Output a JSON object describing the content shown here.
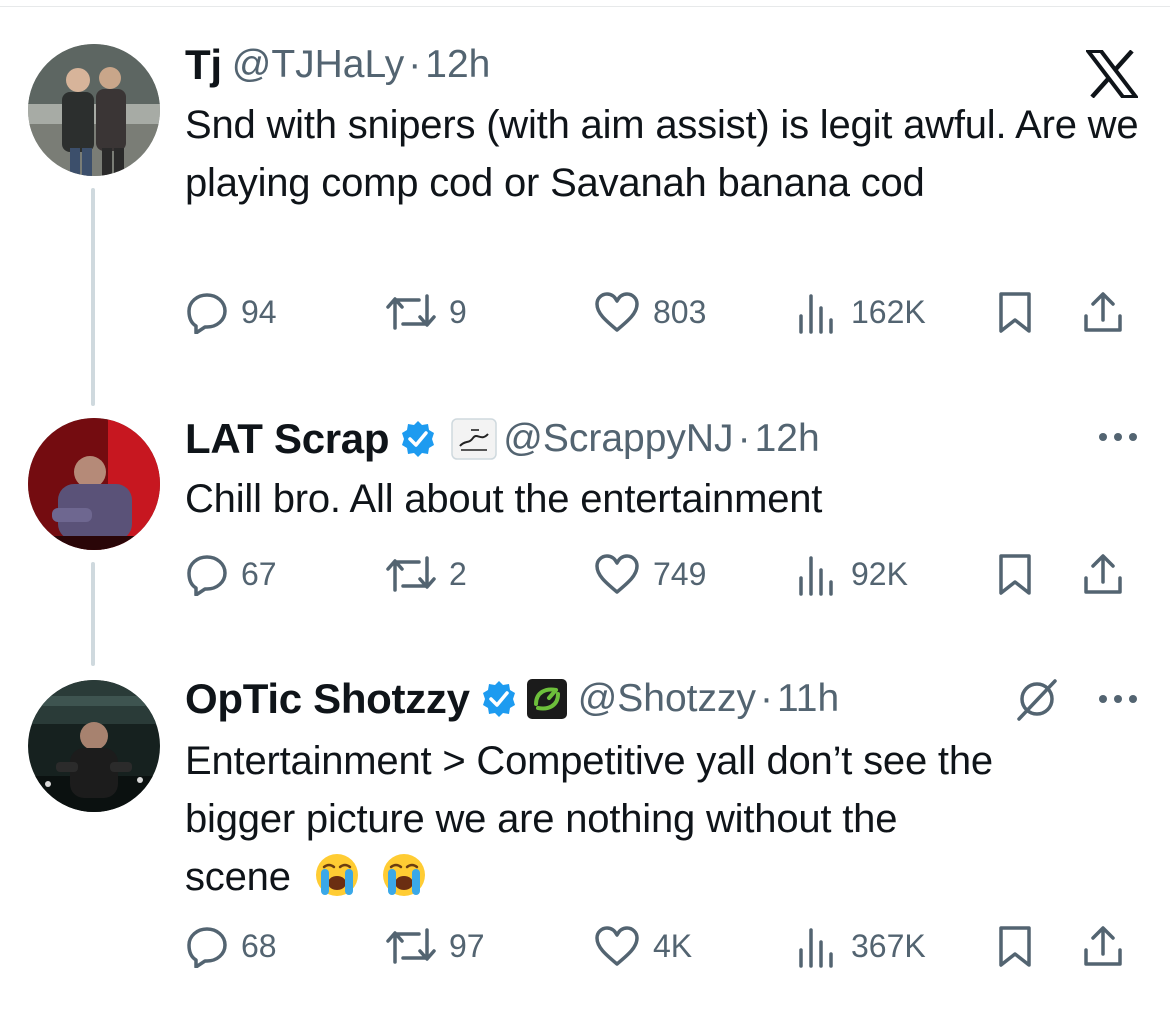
{
  "tweets": [
    {
      "name": "Tj",
      "handle": "@TJHaLy",
      "dot": "·",
      "time": "12h",
      "text": "Snd with snipers (with aim assist) is legit awful. Are we playing comp cod or Savanah banana cod",
      "replies": "94",
      "reposts": "9",
      "likes": "803",
      "views": "162K"
    },
    {
      "name": "LAT Scrap",
      "handle": "@ScrappyNJ",
      "dot": "·",
      "time": "12h",
      "text": "Chill bro. All about the entertainment",
      "replies": "67",
      "reposts": "2",
      "likes": "749",
      "views": "92K"
    },
    {
      "name": "OpTic Shotzzy",
      "handle": "@Shotzzy",
      "dot": "·",
      "time": "11h",
      "text": "Entertainment > Competitive yall don’t see the bigger picture we are nothing without the scene",
      "text_lines": [
        "Entertainment > Competitive yall don’t see the",
        "bigger picture we are nothing without the",
        "scene"
      ],
      "emojis": [
        "loudly-crying-face",
        "loudly-crying-face"
      ],
      "replies": "68",
      "reposts": "97",
      "likes": "4K",
      "views": "367K"
    }
  ],
  "icons": {
    "platform": "x-logo",
    "verified": "verified-badge-icon",
    "reply": "reply-icon",
    "repost": "repost-icon",
    "like": "heart-icon",
    "views": "views-icon",
    "bookmark": "bookmark-icon",
    "share": "share-icon",
    "more": "more-icon",
    "mute": "mute-icon"
  },
  "colors": {
    "text": "#0f1419",
    "secondary": "#536471",
    "verified": "#1d9bf0",
    "thread_line": "#cfd9de",
    "optic_green": "#6dbf3b"
  }
}
